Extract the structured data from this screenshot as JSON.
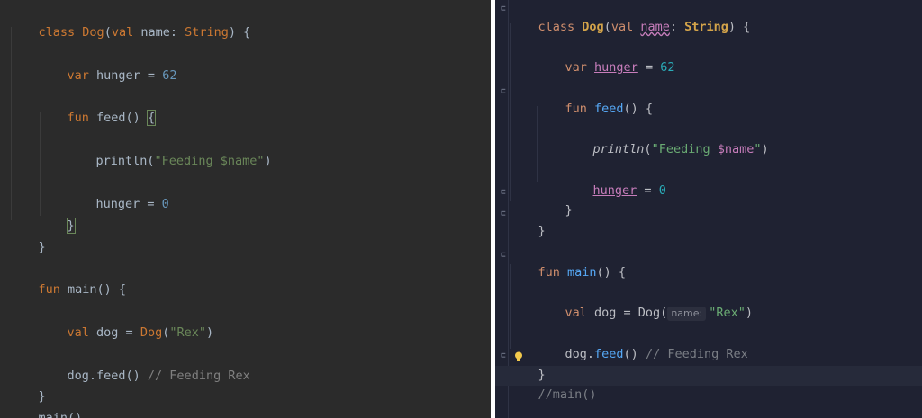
{
  "left_editor": {
    "lines": {
      "l1": {
        "kw": "class ",
        "name": "Dog",
        "p1": "(",
        "kw2": "val ",
        "rest": "name: ",
        "type": "String",
        "end": ") {"
      },
      "l2": {
        "kw": "var ",
        "rest": "hunger = ",
        "num": "62"
      },
      "l3": {
        "kw": "fun ",
        "rest": "feed() ",
        "brace": "{"
      },
      "l4": {
        "fn": "println(",
        "str": "\"Feeding $name\"",
        "end": ")"
      },
      "l5": {
        "rest": "hunger = ",
        "num": "0"
      },
      "l6": {
        "brace": "}"
      },
      "l7": {
        "brace": "}"
      },
      "l8": {
        "kw": "fun ",
        "rest": "main() {"
      },
      "l9": {
        "kw": "val ",
        "rest": "dog = ",
        "type": "Dog",
        "p": "(",
        "str": "\"Rex\"",
        "end": ")"
      },
      "l10": {
        "rest": "dog.feed() ",
        "cmt": "// Feeding Rex"
      },
      "l11": {
        "brace": "}"
      },
      "l12": {
        "rest": "main()"
      }
    }
  },
  "right_editor": {
    "lines": {
      "r1": {
        "kw": "class ",
        "name": "Dog",
        "p1": "(",
        "kw2": "val ",
        "prop": "name",
        "colon": ": ",
        "type": "String",
        "end": ") {"
      },
      "r2": {
        "kw": "var ",
        "prop": "hunger",
        "rest": " = ",
        "num": "62"
      },
      "r3": {
        "kw": "fun ",
        "fn": "feed",
        "rest": "() {"
      },
      "r4": {
        "fn": "println",
        "p": "(",
        "s1": "\"Feeding ",
        "tmpl": "$name",
        "s2": "\"",
        "end": ")"
      },
      "r5": {
        "prop": "hunger",
        "rest": " = ",
        "num": "0"
      },
      "r6": {
        "brace": "}"
      },
      "r7": {
        "brace": "}"
      },
      "r8": {
        "kw": "fun ",
        "fn": "main",
        "rest": "() {"
      },
      "r9": {
        "kw": "val ",
        "rest": "dog = Dog(",
        "hint": "name:",
        "str": "\"Rex\"",
        "end": ")"
      },
      "r10": {
        "rest": "dog.",
        "fn": "feed",
        "rest2": "() ",
        "cmt": "// Feeding Rex"
      },
      "r11": {
        "brace": "}"
      },
      "r12": {
        "cmt": "//main()"
      }
    }
  },
  "icons": {
    "bulb": "lightbulb-icon",
    "fold": "fold-marker-icon"
  },
  "colors": {
    "left_bg": "#2b2b2b",
    "right_bg": "#1f2232",
    "bulb": "#f2c94c"
  }
}
